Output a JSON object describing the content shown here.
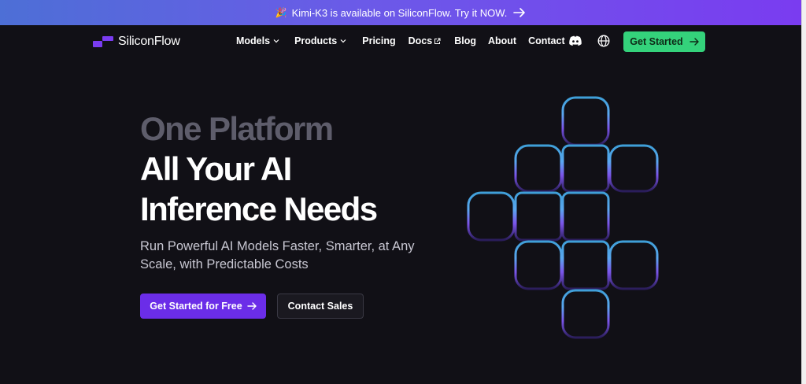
{
  "banner": {
    "party_icon": "party-popper-icon",
    "text": "Kimi-K3 is available on SiliconFlow. Try it NOW.",
    "arrow_icon": "arrow-right-icon"
  },
  "nav": {
    "logo_text": "SiliconFlow",
    "links": [
      {
        "label": "Models",
        "icon": "chevron-down-icon"
      },
      {
        "label": "Products",
        "icon": "chevron-down-icon"
      },
      {
        "label": "Pricing"
      },
      {
        "label": "Docs",
        "icon": "external-link-icon"
      },
      {
        "label": "Blog"
      },
      {
        "label": "About"
      },
      {
        "label": "Contact"
      }
    ],
    "discord_icon": "discord-icon",
    "globe_icon": "globe-icon",
    "cta_label": "Get Started"
  },
  "hero": {
    "line1": "One Platform",
    "line2": "All Your AI",
    "line3": "Inference Needs",
    "subtitle": "Run Powerful AI Models Faster, Smarter, at Any Scale,  with Predictable Costs",
    "primary_button": "Get Started for Free",
    "secondary_button": "Contact Sales"
  },
  "colors": {
    "background": "#111016",
    "brand_purple": "#6b2de8",
    "cta_green": "#34d27b",
    "banner_start": "#4d6fd6",
    "banner_end": "#7a3cf0"
  }
}
